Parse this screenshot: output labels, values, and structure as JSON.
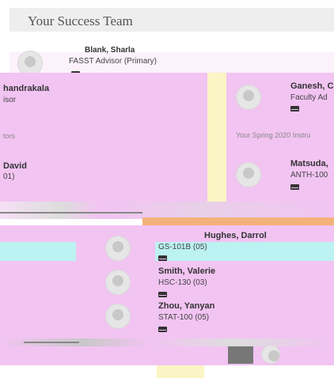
{
  "header": {
    "title": "Your Success Team"
  },
  "top_person": {
    "name": "Blank, Sharla",
    "role": "FASST Advisor (Primary)"
  },
  "left_card_1": {
    "name": "handrakala",
    "role": "isor"
  },
  "left_label": {
    "text": "tors"
  },
  "left_card_2": {
    "name": "David",
    "role": "01)"
  },
  "right_card_1": {
    "name": "Ganesh, C",
    "role": "Faculty Ad"
  },
  "right_label": {
    "text": "Your Spring 2020 Instru"
  },
  "right_card_2": {
    "name": "Matsuda,",
    "role": "ANTH-100"
  },
  "instructors": [
    {
      "name": "Hughes, Darrol",
      "course": "GS-101B (05)"
    },
    {
      "name": "Smith, Valerie",
      "course": "HSC-130 (03)"
    },
    {
      "name": "Zhou, Yanyan",
      "course": "STAT-100 (05)"
    }
  ],
  "colors": {
    "pink": "#f2c4f2",
    "cream": "#fbf4c4",
    "cyan": "#bdf2f2",
    "header_bg": "#eeeeee"
  },
  "icons": [
    "avatar-icon",
    "mail-icon"
  ]
}
